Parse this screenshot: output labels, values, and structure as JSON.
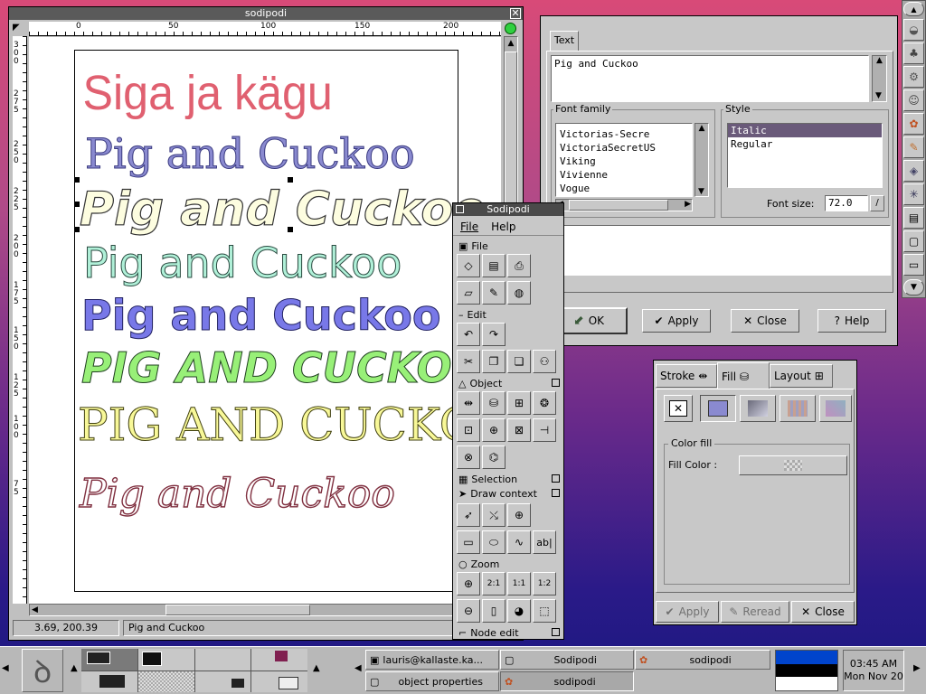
{
  "main_window": {
    "title": "sodipodi",
    "ruler_top_labels": [
      "0",
      "50",
      "100",
      "150",
      "200"
    ],
    "ruler_left_labels": [
      "3 0 0",
      "2 7 5",
      "2 5 0",
      "2 2 5",
      "2 0 0",
      "1 7 5",
      "1 5 0",
      "1 2 5",
      "1 0 0",
      "7 5"
    ],
    "canvas_lines": [
      "Siga ja kägu",
      "Pig and Cuckoo",
      "Pig and Cuckoo",
      "Pig and Cuckoo",
      "Pig and Cuckoo",
      "PIG AND CUCKOO",
      "PIG AND CUCKOO",
      "Pig and Cuckoo"
    ],
    "status_coords": "3.69, 200.39",
    "status_text": "Pig and Cuckoo"
  },
  "text_dialog": {
    "tab": "Text",
    "text_value": "Pig and Cuckoo",
    "font_family_label": "Font family",
    "font_families": [
      "Victorias-Secre",
      "VictoriaSecretUS",
      "Viking",
      "Vivienne",
      "Vogue"
    ],
    "style_label": "Style",
    "styles": [
      "Italic",
      "Regular"
    ],
    "selected_style": "Italic",
    "font_size_label": "Font size:",
    "font_size": "72.0",
    "ok": "OK",
    "apply": "Apply",
    "close": "Close",
    "help": "Help"
  },
  "toolbox": {
    "title": "Sodipodi",
    "menu": [
      "File",
      "Help"
    ],
    "sections": {
      "file": "File",
      "edit": "Edit",
      "object": "Object",
      "selection": "Selection",
      "draw_context": "Draw context",
      "zoom": "Zoom",
      "node_edit": "Node edit"
    }
  },
  "fill_dialog": {
    "tabs": [
      "Stroke",
      "Fill",
      "Layout"
    ],
    "group_label": "Color fill",
    "fill_color_label": "Fill Color :",
    "apply": "Apply",
    "reread": "Reread",
    "close": "Close"
  },
  "taskbar": {
    "tasks": [
      {
        "label": "lauris@kallaste.ka..."
      },
      {
        "label": "Sodipodi"
      },
      {
        "label": "sodipodi"
      },
      {
        "label": "object properties"
      },
      {
        "label": "sodipodi"
      }
    ],
    "clock_time": "03:45 AM",
    "clock_date": "Mon Nov 20"
  }
}
